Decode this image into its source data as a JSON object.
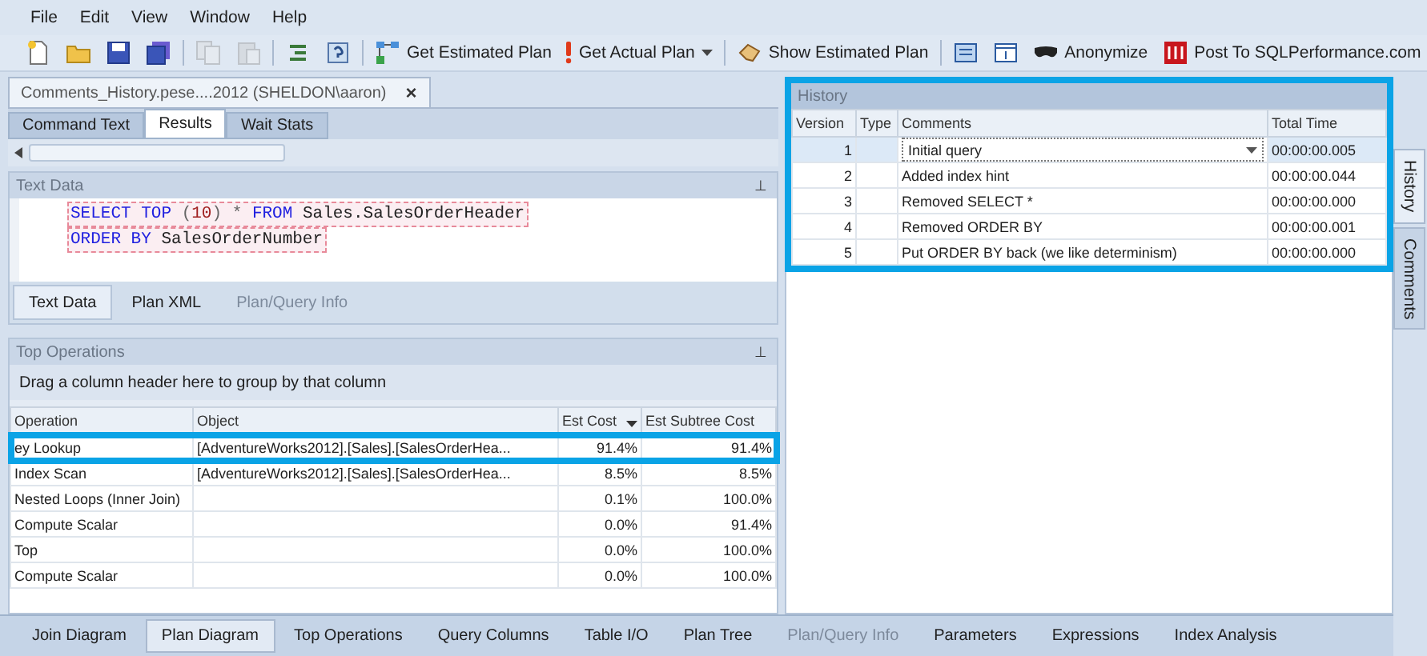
{
  "menu": [
    "File",
    "Edit",
    "View",
    "Window",
    "Help"
  ],
  "toolbar": [
    {
      "kind": "new"
    },
    {
      "kind": "open"
    },
    {
      "kind": "save"
    },
    {
      "kind": "saveall"
    },
    {
      "kind": "sep"
    },
    {
      "kind": "copy",
      "disabled": true
    },
    {
      "kind": "paste",
      "disabled": true
    },
    {
      "kind": "sep"
    },
    {
      "kind": "indent"
    },
    {
      "kind": "help"
    },
    {
      "kind": "sep"
    },
    {
      "kind": "estimated",
      "label": "Get Estimated Plan"
    },
    {
      "kind": "actual",
      "label": "Get Actual Plan",
      "dropdown": true
    },
    {
      "kind": "sep"
    },
    {
      "kind": "show",
      "label": "Show Estimated Plan"
    },
    {
      "kind": "sep"
    },
    {
      "kind": "grid"
    },
    {
      "kind": "window"
    },
    {
      "kind": "mask",
      "label": "Anonymize"
    },
    {
      "kind": "logo",
      "label": "Post To SQLPerformance.com"
    }
  ],
  "document_tab": {
    "title": "Comments_History.pese....2012 (SHELDON\\aaron)",
    "close": "×"
  },
  "result_tabs": [
    {
      "label": "Command Text",
      "selected": false
    },
    {
      "label": "Results",
      "selected": true
    },
    {
      "label": "Wait Stats",
      "selected": false
    }
  ],
  "text_data": {
    "title": "Text Data",
    "pin": "⊥",
    "code": [
      [
        {
          "kind": "keyword",
          "text": "SELECT TOP "
        },
        {
          "kind": "operator",
          "text": "("
        },
        {
          "kind": "number",
          "text": "10"
        },
        {
          "kind": "operator",
          "text": ") * "
        },
        {
          "kind": "keyword",
          "text": "FROM"
        },
        {
          "kind": "plain",
          "text": " Sales.SalesOrderHeader"
        }
      ],
      [
        {
          "kind": "keyword",
          "text": "ORDER BY"
        },
        {
          "kind": "plain",
          "text": " SalesOrderNumber"
        }
      ]
    ],
    "tabs": [
      {
        "label": "Text Data",
        "selected": true,
        "disabled": false
      },
      {
        "label": "Plan XML",
        "selected": false,
        "disabled": false
      },
      {
        "label": "Plan/Query Info",
        "selected": false,
        "disabled": true
      }
    ]
  },
  "top_operations": {
    "title": "Top Operations",
    "pin": "⊥",
    "group_hint": "Drag a column header here to group by that column",
    "columns": [
      {
        "label": "Operation",
        "sorted": false
      },
      {
        "label": "Object",
        "sorted": false
      },
      {
        "label": "Est Cost",
        "sorted": true
      },
      {
        "label": "Est Subtree Cost",
        "sorted": false
      }
    ],
    "rows": [
      {
        "cells": [
          "ey Lookup",
          "[AdventureWorks2012].[Sales].[SalesOrderHea...",
          "91.4%",
          "91.4%"
        ],
        "highlighted": true
      },
      {
        "cells": [
          "Index Scan",
          "[AdventureWorks2012].[Sales].[SalesOrderHea...",
          "8.5%",
          "8.5%"
        ],
        "highlighted": false
      },
      {
        "cells": [
          "Nested Loops (Inner Join)",
          "",
          "0.1%",
          "100.0%"
        ],
        "highlighted": false
      },
      {
        "cells": [
          "Compute Scalar",
          "",
          "0.0%",
          "91.4%"
        ],
        "highlighted": false
      },
      {
        "cells": [
          "Top",
          "",
          "0.0%",
          "100.0%"
        ],
        "highlighted": false
      },
      {
        "cells": [
          "Compute Scalar",
          "",
          "0.0%",
          "100.0%"
        ],
        "highlighted": false
      }
    ]
  },
  "history": {
    "title": "History",
    "highlighted": true,
    "columns": [
      "Version",
      "Type",
      "Comments",
      "Total Time"
    ],
    "rows": [
      {
        "version": "1",
        "type": "",
        "comment": "Initial query",
        "time": "00:00:00.005",
        "selected": true
      },
      {
        "version": "2",
        "type": "",
        "comment": "Added index hint",
        "time": "00:00:00.044",
        "selected": false
      },
      {
        "version": "3",
        "type": "",
        "comment": "Removed SELECT *",
        "time": "00:00:00.000",
        "selected": false
      },
      {
        "version": "4",
        "type": "",
        "comment": "Removed ORDER BY",
        "time": "00:00:00.001",
        "selected": false
      },
      {
        "version": "5",
        "type": "",
        "comment": "Put ORDER BY back (we like determinism)",
        "time": "00:00:00.000",
        "selected": false
      }
    ]
  },
  "side_tabs": [
    {
      "label": "History",
      "selected": true
    },
    {
      "label": "Comments",
      "selected": false
    }
  ],
  "bottom_tabs": [
    {
      "label": "Join Diagram",
      "selected": false,
      "disabled": false
    },
    {
      "label": "Plan Diagram",
      "selected": true,
      "disabled": false
    },
    {
      "label": "Top Operations",
      "selected": false,
      "disabled": false
    },
    {
      "label": "Query Columns",
      "selected": false,
      "disabled": false
    },
    {
      "label": "Table I/O",
      "selected": false,
      "disabled": false
    },
    {
      "label": "Plan Tree",
      "selected": false,
      "disabled": false
    },
    {
      "label": "Plan/Query Info",
      "selected": false,
      "disabled": true
    },
    {
      "label": "Parameters",
      "selected": false,
      "disabled": false
    },
    {
      "label": "Expressions",
      "selected": false,
      "disabled": false
    },
    {
      "label": "Index Analysis",
      "selected": false,
      "disabled": false
    }
  ]
}
